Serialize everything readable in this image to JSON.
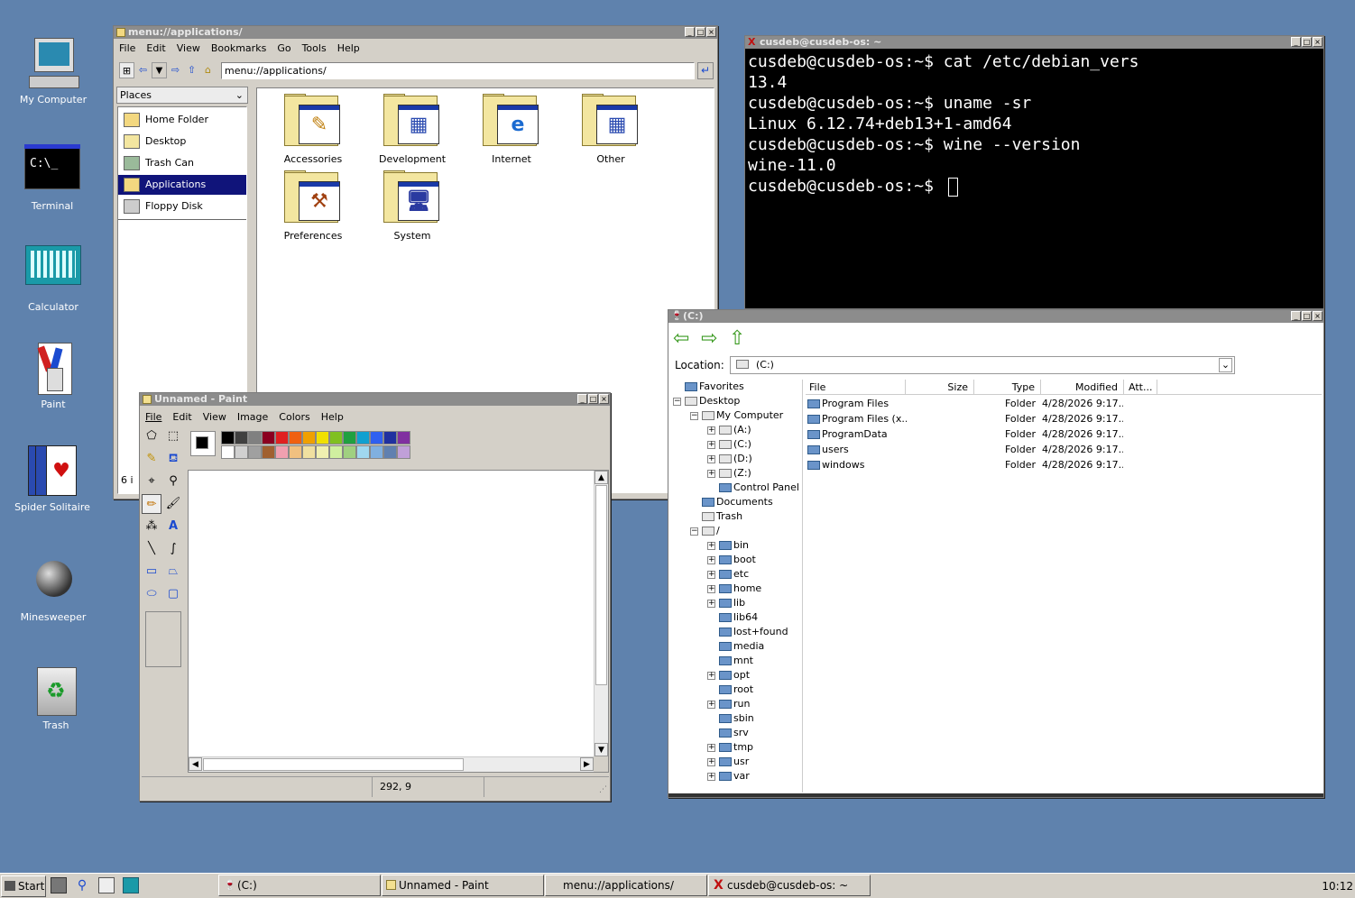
{
  "desktop": {
    "icons": [
      "My Computer",
      "Terminal",
      "Calculator",
      "Paint",
      "Spider Solitaire",
      "Minesweeper",
      "Trash"
    ],
    "terminal_icon_text": "C:\\_"
  },
  "filemanager": {
    "title": "menu://applications/",
    "menu": [
      "File",
      "Edit",
      "View",
      "Bookmarks",
      "Go",
      "Tools",
      "Help"
    ],
    "address": "menu://applications/",
    "places_label": "Places",
    "places": [
      "Home Folder",
      "Desktop",
      "Trash Can",
      "Applications",
      "Floppy Disk"
    ],
    "selected_place": "Applications",
    "items": [
      "Accessories",
      "Development",
      "Internet",
      "Other",
      "Preferences",
      "System"
    ],
    "status": "6 i"
  },
  "terminal": {
    "title": "cusdeb@cusdeb-os: ~",
    "lines": [
      "cusdeb@cusdeb-os:~$ cat /etc/debian_vers",
      "13.4",
      "cusdeb@cusdeb-os:~$ uname -sr",
      "Linux 6.12.74+deb13+1-amd64",
      "cusdeb@cusdeb-os:~$ wine --version",
      "wine-11.0",
      "cusdeb@cusdeb-os:~$ "
    ]
  },
  "explorer": {
    "title": "(C:)",
    "location_label": "Location:",
    "location_value": "(C:)",
    "columns": [
      "File",
      "Size",
      "Type",
      "Modified",
      "Att..."
    ],
    "files": [
      {
        "name": "Program Files",
        "type": "Folder",
        "modified": "4/28/2026 9:17.."
      },
      {
        "name": "Program Files (x...",
        "type": "Folder",
        "modified": "4/28/2026 9:17.."
      },
      {
        "name": "ProgramData",
        "type": "Folder",
        "modified": "4/28/2026 9:17.."
      },
      {
        "name": "users",
        "type": "Folder",
        "modified": "4/28/2026 9:17.."
      },
      {
        "name": "windows",
        "type": "Folder",
        "modified": "4/28/2026 9:17.."
      }
    ],
    "tree": [
      {
        "label": "Favorites",
        "indent": 0,
        "exp": "",
        "icon": "fld"
      },
      {
        "label": "Desktop",
        "indent": 0,
        "exp": "−",
        "icon": "drv"
      },
      {
        "label": "My Computer",
        "indent": 1,
        "exp": "−",
        "icon": "drv"
      },
      {
        "label": "(A:)",
        "indent": 2,
        "exp": "+",
        "icon": "drv"
      },
      {
        "label": "(C:)",
        "indent": 2,
        "exp": "+",
        "icon": "drv"
      },
      {
        "label": "(D:)",
        "indent": 2,
        "exp": "+",
        "icon": "drv"
      },
      {
        "label": "(Z:)",
        "indent": 2,
        "exp": "+",
        "icon": "drv"
      },
      {
        "label": "Control Panel",
        "indent": 2,
        "exp": "",
        "icon": "fld"
      },
      {
        "label": "Documents",
        "indent": 1,
        "exp": "",
        "icon": "fld"
      },
      {
        "label": "Trash",
        "indent": 1,
        "exp": "",
        "icon": "drv"
      },
      {
        "label": "/",
        "indent": 1,
        "exp": "−",
        "icon": "drv"
      },
      {
        "label": "bin",
        "indent": 2,
        "exp": "+",
        "icon": "fld"
      },
      {
        "label": "boot",
        "indent": 2,
        "exp": "+",
        "icon": "fld"
      },
      {
        "label": "etc",
        "indent": 2,
        "exp": "+",
        "icon": "fld"
      },
      {
        "label": "home",
        "indent": 2,
        "exp": "+",
        "icon": "fld"
      },
      {
        "label": "lib",
        "indent": 2,
        "exp": "+",
        "icon": "fld"
      },
      {
        "label": "lib64",
        "indent": 2,
        "exp": "",
        "icon": "fld"
      },
      {
        "label": "lost+found",
        "indent": 2,
        "exp": "",
        "icon": "fld"
      },
      {
        "label": "media",
        "indent": 2,
        "exp": "",
        "icon": "fld"
      },
      {
        "label": "mnt",
        "indent": 2,
        "exp": "",
        "icon": "fld"
      },
      {
        "label": "opt",
        "indent": 2,
        "exp": "+",
        "icon": "fld"
      },
      {
        "label": "root",
        "indent": 2,
        "exp": "",
        "icon": "fld"
      },
      {
        "label": "run",
        "indent": 2,
        "exp": "+",
        "icon": "fld"
      },
      {
        "label": "sbin",
        "indent": 2,
        "exp": "",
        "icon": "fld"
      },
      {
        "label": "srv",
        "indent": 2,
        "exp": "",
        "icon": "fld"
      },
      {
        "label": "tmp",
        "indent": 2,
        "exp": "+",
        "icon": "fld"
      },
      {
        "label": "usr",
        "indent": 2,
        "exp": "+",
        "icon": "fld"
      },
      {
        "label": "var",
        "indent": 2,
        "exp": "+",
        "icon": "fld"
      }
    ]
  },
  "paint": {
    "title": "Unnamed - Paint",
    "menu": [
      "File",
      "Edit",
      "View",
      "Image",
      "Colors",
      "Help"
    ],
    "palette_top": [
      "#000000",
      "#404040",
      "#808080",
      "#8b0020",
      "#e02020",
      "#f06010",
      "#f0a000",
      "#f0e000",
      "#80c020",
      "#20a040",
      "#10a0d0",
      "#3060f0",
      "#2030a0",
      "#8030a0"
    ],
    "palette_bottom": [
      "#ffffff",
      "#d0d0d0",
      "#a0a0a0",
      "#a06030",
      "#f0a0b0",
      "#f0c080",
      "#f0e0a0",
      "#f0f0b0",
      "#d0f0a0",
      "#a0d080",
      "#a0d8f0",
      "#80b0e0",
      "#6080b0",
      "#c0a0d8"
    ],
    "status_coords": "292, 9"
  },
  "taskbar": {
    "start": "Start",
    "tasks": [
      "(C:)",
      "Unnamed - Paint",
      "menu://applications/",
      "cusdeb@cusdeb-os: ~"
    ],
    "clock": "10:12"
  }
}
